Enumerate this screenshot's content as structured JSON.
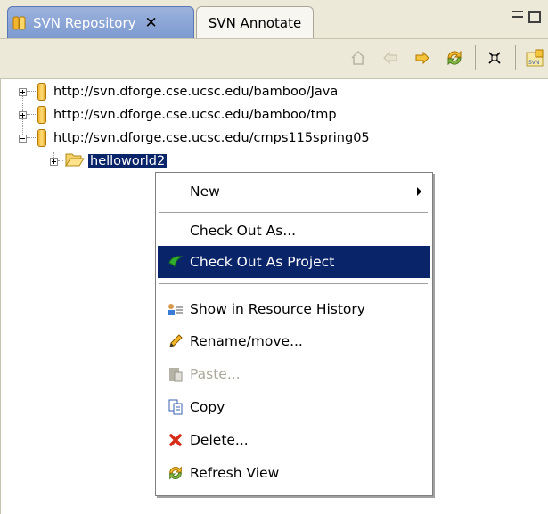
{
  "tabs": [
    {
      "label": "SVN Repository",
      "active": true,
      "closable": true,
      "icon": "repository-icon"
    },
    {
      "label": "SVN Annotate",
      "active": false
    }
  ],
  "view_controls": {
    "minimize_icon": "minimize-icon",
    "maximize_icon": "maximize-icon"
  },
  "toolbar": {
    "icons": [
      "home-icon",
      "back-arrow-icon",
      "forward-arrow-icon",
      "refresh-icon",
      "collapse-all-icon",
      "new-repository-location-icon"
    ]
  },
  "tree": {
    "repositories": [
      {
        "url": "http://svn.dforge.cse.ucsc.edu/bamboo/Java",
        "expanded": false
      },
      {
        "url": "http://svn.dforge.cse.ucsc.edu/bamboo/tmp",
        "expanded": false
      },
      {
        "url": "http://svn.dforge.cse.ucsc.edu/cmps115spring05",
        "expanded": true
      }
    ],
    "child_folder": {
      "label": "helloworld2",
      "selected": true
    }
  },
  "context_menu": {
    "items": {
      "new": "New",
      "check_out_as": "Check Out As...",
      "check_out_as_project": "Check Out As Project",
      "show_in_resource_history": "Show in Resource History",
      "rename_move": "Rename/move...",
      "paste": "Paste...",
      "copy": "Copy",
      "delete": "Delete...",
      "refresh_view": "Refresh View"
    },
    "highlighted": "Check Out As Project",
    "disabled": [
      "Paste..."
    ]
  },
  "colors": {
    "selection": "#0a246a",
    "panel_bg": "#ece9d8",
    "active_tab": "#7d9ad0",
    "disabled_text": "#aca899"
  }
}
